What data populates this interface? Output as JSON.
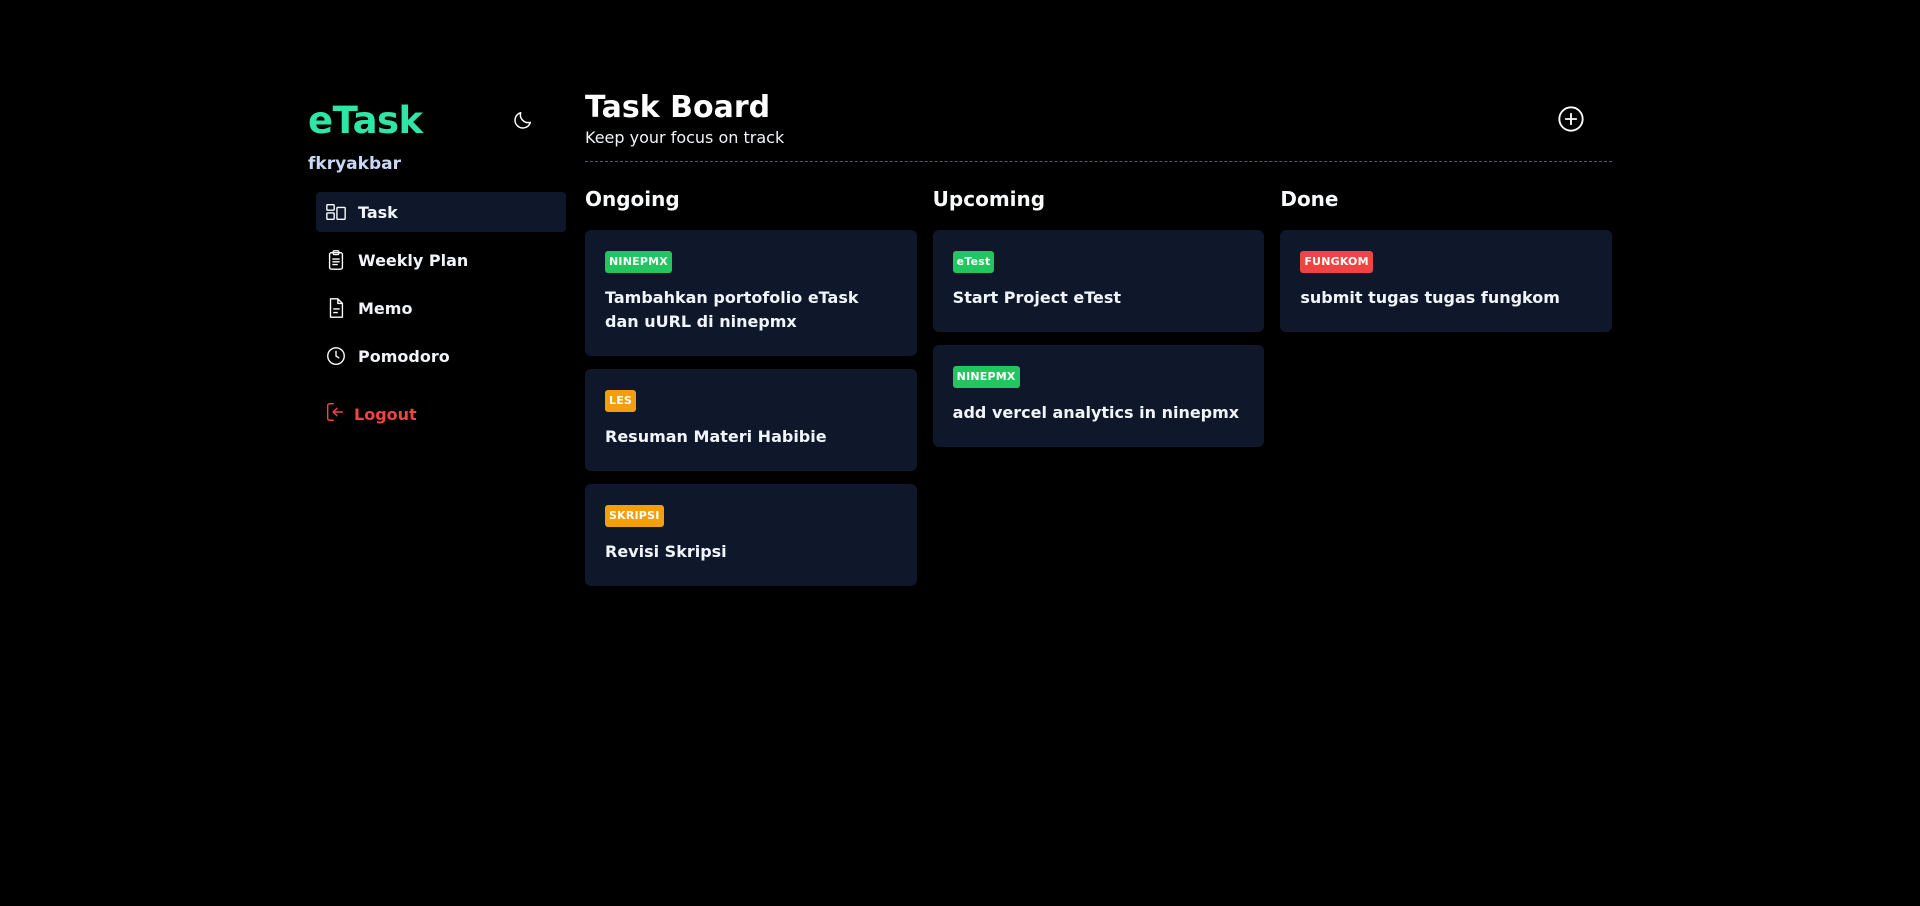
{
  "sidebar": {
    "brand": "eTask",
    "username": "fkryakbar",
    "items": [
      {
        "label": "Task",
        "icon": "task-board-icon",
        "active": true
      },
      {
        "label": "Weekly Plan",
        "icon": "clipboard-icon",
        "active": false
      },
      {
        "label": "Memo",
        "icon": "document-icon",
        "active": false
      },
      {
        "label": "Pomodoro",
        "icon": "clock-icon",
        "active": false
      }
    ],
    "logout_label": "Logout",
    "theme_icon": "moon-icon"
  },
  "header": {
    "title": "Task Board",
    "subtitle": "Keep your focus on track",
    "add_icon": "plus-circle-icon"
  },
  "columns": [
    {
      "title": "Ongoing",
      "cards": [
        {
          "tag": "NINEPMX",
          "tag_color": "#22c55e",
          "title": "Tambahkan portofolio eTask dan uURL di ninepmx"
        },
        {
          "tag": "LES",
          "tag_color": "#f59e0b",
          "title": "Resuman Materi Habibie"
        },
        {
          "tag": "SKRIPSI",
          "tag_color": "#f59e0b",
          "title": "Revisi Skripsi"
        }
      ]
    },
    {
      "title": "Upcoming",
      "cards": [
        {
          "tag": "eTest",
          "tag_color": "#22c55e",
          "title": "Start Project eTest"
        },
        {
          "tag": "NINEPMX",
          "tag_color": "#22c55e",
          "title": "add vercel analytics in ninepmx"
        }
      ]
    },
    {
      "title": "Done",
      "cards": [
        {
          "tag": "FUNGKOM",
          "tag_color": "#ef4444",
          "title": "submit tugas tugas fungkom"
        }
      ]
    }
  ],
  "colors": {
    "brand": "#2ee6a8",
    "background": "#000000",
    "card": "#0f172a",
    "logout": "#ef4444"
  }
}
